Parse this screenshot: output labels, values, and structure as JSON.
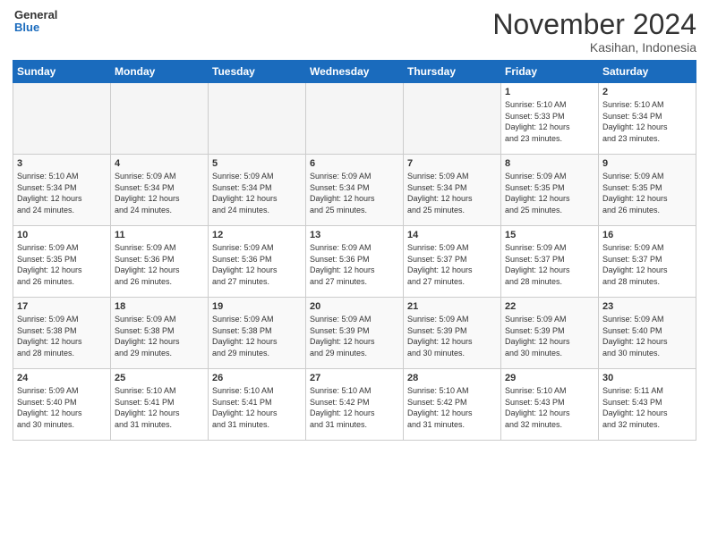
{
  "header": {
    "logo_line1": "General",
    "logo_line2": "Blue",
    "month": "November 2024",
    "location": "Kasihan, Indonesia"
  },
  "weekdays": [
    "Sunday",
    "Monday",
    "Tuesday",
    "Wednesday",
    "Thursday",
    "Friday",
    "Saturday"
  ],
  "weeks": [
    [
      {
        "day": "",
        "info": ""
      },
      {
        "day": "",
        "info": ""
      },
      {
        "day": "",
        "info": ""
      },
      {
        "day": "",
        "info": ""
      },
      {
        "day": "",
        "info": ""
      },
      {
        "day": "1",
        "info": "Sunrise: 5:10 AM\nSunset: 5:33 PM\nDaylight: 12 hours\nand 23 minutes."
      },
      {
        "day": "2",
        "info": "Sunrise: 5:10 AM\nSunset: 5:34 PM\nDaylight: 12 hours\nand 23 minutes."
      }
    ],
    [
      {
        "day": "3",
        "info": "Sunrise: 5:10 AM\nSunset: 5:34 PM\nDaylight: 12 hours\nand 24 minutes."
      },
      {
        "day": "4",
        "info": "Sunrise: 5:09 AM\nSunset: 5:34 PM\nDaylight: 12 hours\nand 24 minutes."
      },
      {
        "day": "5",
        "info": "Sunrise: 5:09 AM\nSunset: 5:34 PM\nDaylight: 12 hours\nand 24 minutes."
      },
      {
        "day": "6",
        "info": "Sunrise: 5:09 AM\nSunset: 5:34 PM\nDaylight: 12 hours\nand 25 minutes."
      },
      {
        "day": "7",
        "info": "Sunrise: 5:09 AM\nSunset: 5:34 PM\nDaylight: 12 hours\nand 25 minutes."
      },
      {
        "day": "8",
        "info": "Sunrise: 5:09 AM\nSunset: 5:35 PM\nDaylight: 12 hours\nand 25 minutes."
      },
      {
        "day": "9",
        "info": "Sunrise: 5:09 AM\nSunset: 5:35 PM\nDaylight: 12 hours\nand 26 minutes."
      }
    ],
    [
      {
        "day": "10",
        "info": "Sunrise: 5:09 AM\nSunset: 5:35 PM\nDaylight: 12 hours\nand 26 minutes."
      },
      {
        "day": "11",
        "info": "Sunrise: 5:09 AM\nSunset: 5:36 PM\nDaylight: 12 hours\nand 26 minutes."
      },
      {
        "day": "12",
        "info": "Sunrise: 5:09 AM\nSunset: 5:36 PM\nDaylight: 12 hours\nand 27 minutes."
      },
      {
        "day": "13",
        "info": "Sunrise: 5:09 AM\nSunset: 5:36 PM\nDaylight: 12 hours\nand 27 minutes."
      },
      {
        "day": "14",
        "info": "Sunrise: 5:09 AM\nSunset: 5:37 PM\nDaylight: 12 hours\nand 27 minutes."
      },
      {
        "day": "15",
        "info": "Sunrise: 5:09 AM\nSunset: 5:37 PM\nDaylight: 12 hours\nand 28 minutes."
      },
      {
        "day": "16",
        "info": "Sunrise: 5:09 AM\nSunset: 5:37 PM\nDaylight: 12 hours\nand 28 minutes."
      }
    ],
    [
      {
        "day": "17",
        "info": "Sunrise: 5:09 AM\nSunset: 5:38 PM\nDaylight: 12 hours\nand 28 minutes."
      },
      {
        "day": "18",
        "info": "Sunrise: 5:09 AM\nSunset: 5:38 PM\nDaylight: 12 hours\nand 29 minutes."
      },
      {
        "day": "19",
        "info": "Sunrise: 5:09 AM\nSunset: 5:38 PM\nDaylight: 12 hours\nand 29 minutes."
      },
      {
        "day": "20",
        "info": "Sunrise: 5:09 AM\nSunset: 5:39 PM\nDaylight: 12 hours\nand 29 minutes."
      },
      {
        "day": "21",
        "info": "Sunrise: 5:09 AM\nSunset: 5:39 PM\nDaylight: 12 hours\nand 30 minutes."
      },
      {
        "day": "22",
        "info": "Sunrise: 5:09 AM\nSunset: 5:39 PM\nDaylight: 12 hours\nand 30 minutes."
      },
      {
        "day": "23",
        "info": "Sunrise: 5:09 AM\nSunset: 5:40 PM\nDaylight: 12 hours\nand 30 minutes."
      }
    ],
    [
      {
        "day": "24",
        "info": "Sunrise: 5:09 AM\nSunset: 5:40 PM\nDaylight: 12 hours\nand 30 minutes."
      },
      {
        "day": "25",
        "info": "Sunrise: 5:10 AM\nSunset: 5:41 PM\nDaylight: 12 hours\nand 31 minutes."
      },
      {
        "day": "26",
        "info": "Sunrise: 5:10 AM\nSunset: 5:41 PM\nDaylight: 12 hours\nand 31 minutes."
      },
      {
        "day": "27",
        "info": "Sunrise: 5:10 AM\nSunset: 5:42 PM\nDaylight: 12 hours\nand 31 minutes."
      },
      {
        "day": "28",
        "info": "Sunrise: 5:10 AM\nSunset: 5:42 PM\nDaylight: 12 hours\nand 31 minutes."
      },
      {
        "day": "29",
        "info": "Sunrise: 5:10 AM\nSunset: 5:43 PM\nDaylight: 12 hours\nand 32 minutes."
      },
      {
        "day": "30",
        "info": "Sunrise: 5:11 AM\nSunset: 5:43 PM\nDaylight: 12 hours\nand 32 minutes."
      }
    ]
  ]
}
